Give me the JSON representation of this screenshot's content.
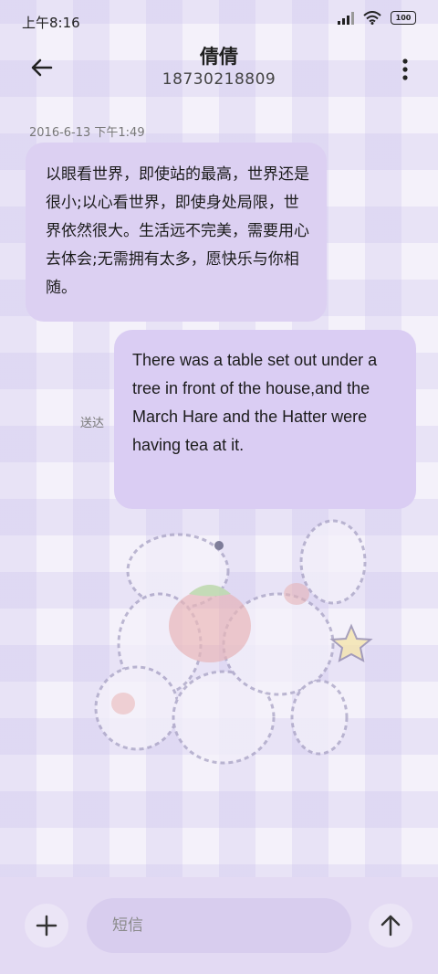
{
  "status_bar": {
    "time": "上午8:16",
    "battery": "100"
  },
  "contact": {
    "name": "倩倩",
    "phone": "18730218809"
  },
  "thread": {
    "timestamp": "2016-6-13 下午1:49",
    "received_message": "以眼看世界，即使站的最高，世界还是很小;以心看世界，即使身处局限，世界依然很大。生活远不完美，需要用心去体会;无需拥有太多，愿快乐与你相随。",
    "sent_message": "There was a table set out under a tree in front of the house,and the March Hare and the Hatter were having tea at it.",
    "sent_status": "送达"
  },
  "composer": {
    "placeholder": "短信"
  },
  "icons": {
    "back": "arrow-left-icon",
    "more": "more-vertical-icon",
    "add": "plus-icon",
    "send": "arrow-up-icon"
  }
}
